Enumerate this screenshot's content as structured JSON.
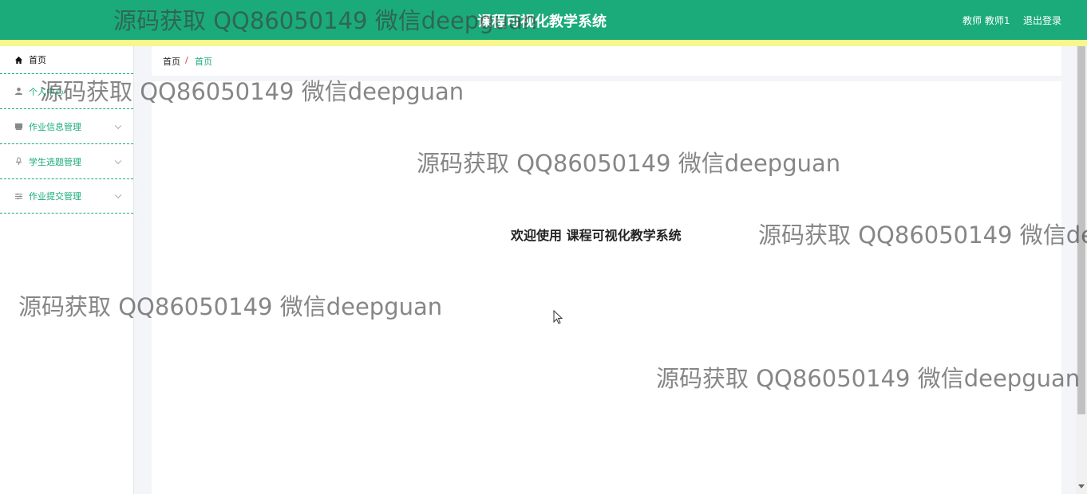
{
  "header": {
    "app_title": "课程可视化教学系统",
    "user_info": "教师 教师1",
    "logout_label": "退出登录"
  },
  "sidebar": {
    "items": [
      {
        "label": "首页",
        "icon": "home-icon"
      },
      {
        "label": "个人中心",
        "icon": "user-icon"
      },
      {
        "label": "作业信息管理",
        "icon": "folder-icon"
      },
      {
        "label": "学生选题管理",
        "icon": "microphone-icon"
      },
      {
        "label": "作业提交管理",
        "icon": "sliders-icon"
      }
    ]
  },
  "breadcrumb": {
    "home": "首页",
    "separator": "/",
    "current": "首页"
  },
  "main": {
    "welcome": "欢迎使用 课程可视化教学系统"
  },
  "watermark": {
    "text": "源码获取 QQ86050149 微信deepguan"
  },
  "colors": {
    "primary": "#1bab7b",
    "header_stripe": "#f7f78c"
  }
}
